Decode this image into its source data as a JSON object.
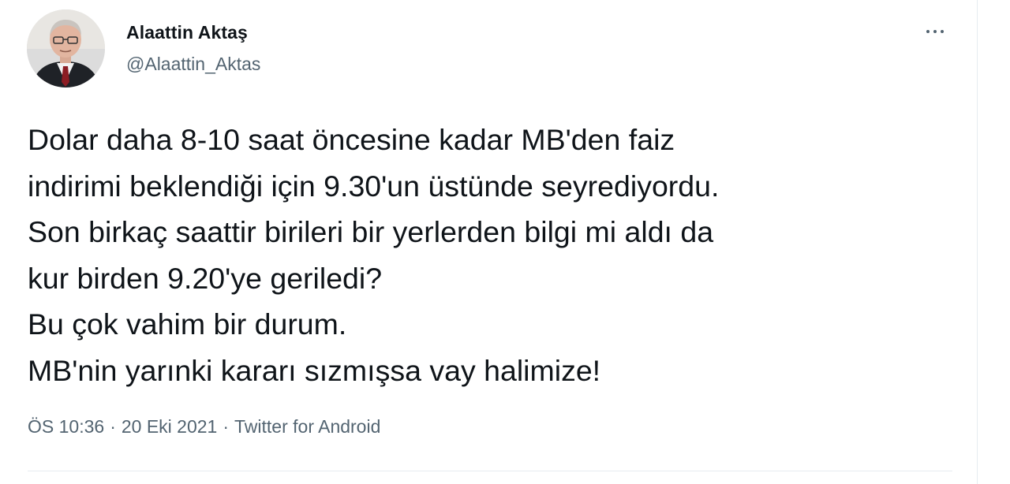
{
  "author": {
    "name": "Alaattin Aktaş",
    "handle": "@Alaattin_Aktas"
  },
  "tweet": {
    "lines": [
      "Dolar daha 8-10 saat öncesine kadar MB'den faiz",
      "indirimi beklendiği için 9.30'un üstünde seyrediyordu.",
      "Son birkaç saattir birileri bir yerlerden bilgi mi aldı da",
      "kur birden 9.20'ye geriledi?",
      "Bu çok vahim bir durum.",
      "MB'nin yarınki kararı sızmışsa vay halimize!"
    ],
    "time": "ÖS 10:36",
    "date": "20 Eki 2021",
    "source": "Twitter for Android",
    "separator": "·"
  },
  "icons": {
    "more": "more-horizontal-icon"
  },
  "colors": {
    "text": "#0f1419",
    "secondary": "#536471",
    "divider": "#e6ecf0"
  }
}
